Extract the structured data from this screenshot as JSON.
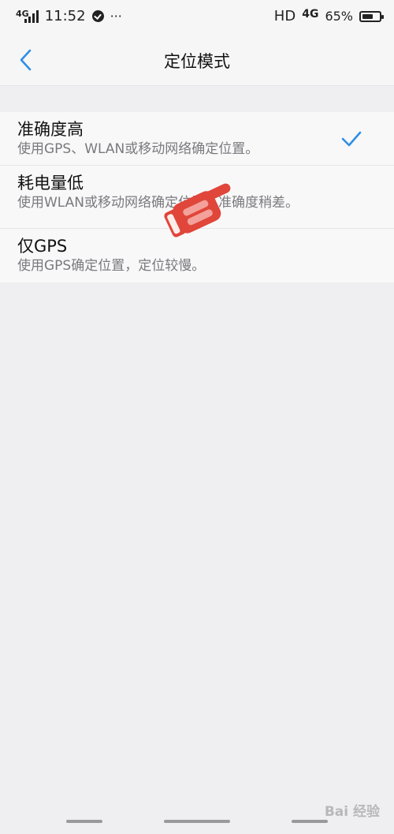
{
  "status_bar": {
    "network_left": "4G",
    "time": "11:52",
    "more": "···",
    "hd": "HD",
    "network_right": "4G",
    "battery_percent": "65%",
    "battery_level": 0.65
  },
  "header": {
    "title": "定位模式",
    "back_icon": "chevron-left-icon"
  },
  "modes": [
    {
      "title": "准确度高",
      "description": "使用GPS、WLAN或移动网络确定位置。",
      "selected": true
    },
    {
      "title": "耗电量低",
      "description": "使用WLAN或移动网络确定位置，准确度稍差。",
      "selected": false
    },
    {
      "title": "仅GPS",
      "description": "使用GPS确定位置，定位较慢。",
      "selected": false
    }
  ],
  "colors": {
    "accent": "#2f8ee6",
    "pointer": "#e0463a",
    "background": "#efeff1"
  },
  "watermark": {
    "text": "Bai 经验"
  }
}
